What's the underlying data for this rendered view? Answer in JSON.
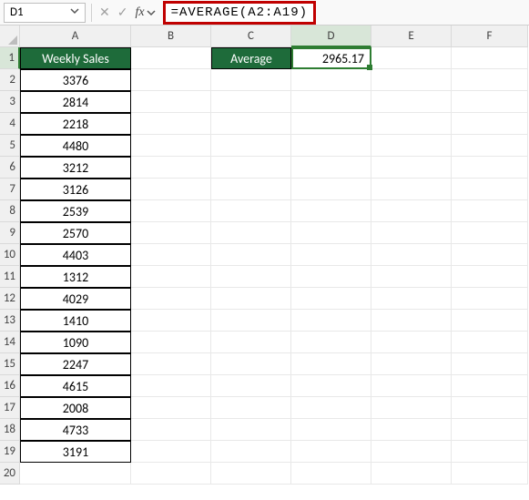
{
  "name_box": "D1",
  "formula": "=AVERAGE(A2:A19)",
  "fx_label": "fx",
  "columns": [
    "A",
    "B",
    "C",
    "D",
    "E",
    "F"
  ],
  "rows": [
    "1",
    "2",
    "3",
    "4",
    "5",
    "6",
    "7",
    "8",
    "9",
    "10",
    "11",
    "12",
    "13",
    "14",
    "15",
    "16",
    "17",
    "18",
    "19",
    "20"
  ],
  "headerA": "Weekly Sales",
  "avg_label": "Average",
  "avg_value": "2965.17",
  "sales": [
    "3376",
    "2814",
    "2218",
    "4480",
    "3212",
    "3126",
    "2539",
    "2570",
    "4403",
    "1312",
    "4029",
    "1410",
    "1090",
    "2247",
    "4615",
    "2008",
    "4733",
    "3191"
  ],
  "chart_data": {
    "type": "table",
    "title": "Weekly Sales spreadsheet with AVERAGE formula",
    "columns": [
      "Weekly Sales"
    ],
    "values": [
      3376,
      2814,
      2218,
      4480,
      3212,
      3126,
      2539,
      2570,
      4403,
      1312,
      4029,
      1410,
      1090,
      2247,
      4615,
      2008,
      4733,
      3191
    ],
    "aggregate": {
      "label": "Average",
      "value": 2965.17,
      "formula": "=AVERAGE(A2:A19)"
    }
  }
}
